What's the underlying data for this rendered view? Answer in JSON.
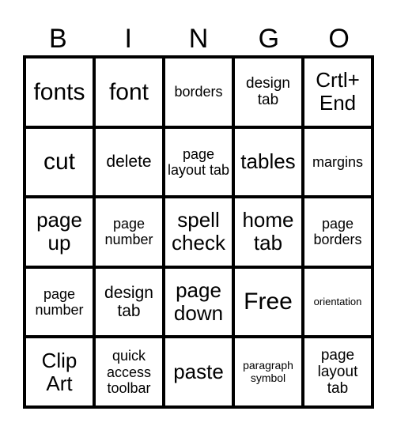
{
  "header": {
    "letters": [
      "B",
      "I",
      "N",
      "G",
      "O"
    ]
  },
  "card": {
    "rows": [
      [
        "fonts",
        "font",
        "borders",
        "design tab",
        "Crtl+ End"
      ],
      [
        "cut",
        "delete",
        "page layout tab",
        "tables",
        "margins"
      ],
      [
        "page up",
        "page number",
        "spell check",
        "home tab",
        "page borders"
      ],
      [
        "page number",
        "design tab",
        "page down",
        "Free",
        "orientation"
      ],
      [
        "Clip Art",
        "quick access toolbar",
        "paste",
        "paragraph symbol",
        "page layout tab"
      ]
    ]
  }
}
